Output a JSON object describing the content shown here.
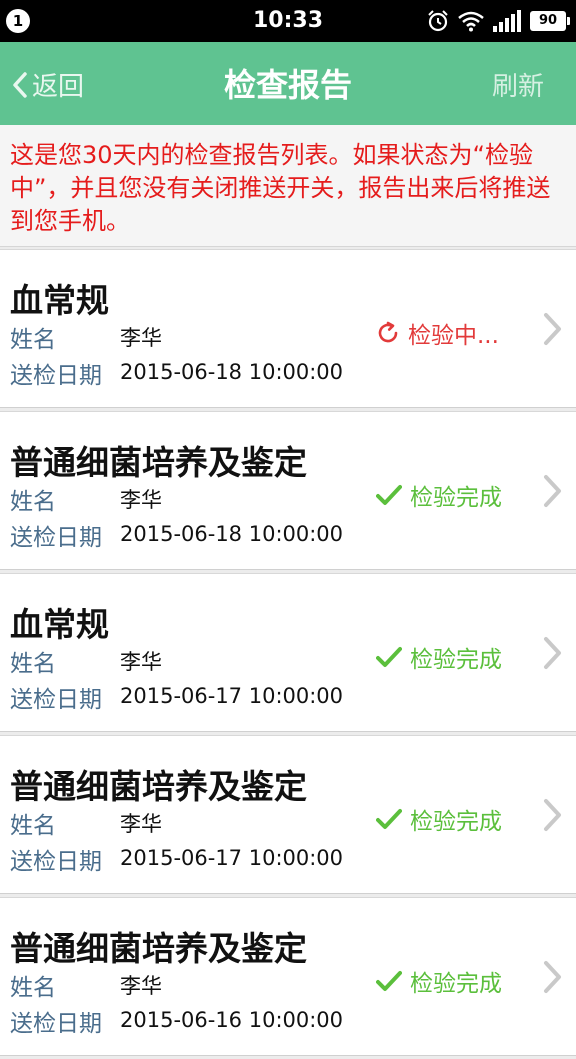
{
  "status_bar": {
    "notification_count": "1",
    "time": "10:33",
    "battery": "90"
  },
  "nav": {
    "back_label": "返回",
    "title": "检查报告",
    "refresh_label": "刷新"
  },
  "notice": "这是您30天内的检查报告列表。如果状态为“检验中”，并且您没有关闭推送开关，报告出来后将推送到您手机。",
  "labels": {
    "name": "姓名",
    "date": "送检日期"
  },
  "reports": [
    {
      "title": "血常规",
      "patient": "李华",
      "date": "2015-06-18 10:00:00",
      "status": "检验中...",
      "state": "pending"
    },
    {
      "title": "普通细菌培养及鉴定",
      "patient": "李华",
      "date": "2015-06-18 10:00:00",
      "status": "检验完成",
      "state": "done"
    },
    {
      "title": "血常规",
      "patient": "李华",
      "date": "2015-06-17 10:00:00",
      "status": "检验完成",
      "state": "done"
    },
    {
      "title": "普通细菌培养及鉴定",
      "patient": "李华",
      "date": "2015-06-17 10:00:00",
      "status": "检验完成",
      "state": "done"
    },
    {
      "title": "普通细菌培养及鉴定",
      "patient": "李华",
      "date": "2015-06-16 10:00:00",
      "status": "检验完成",
      "state": "done"
    }
  ]
}
